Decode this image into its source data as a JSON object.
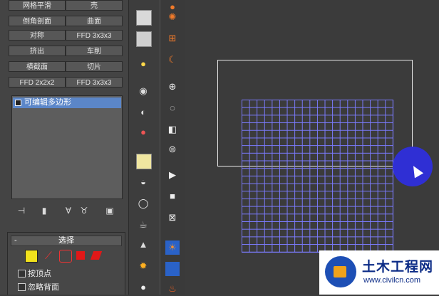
{
  "modifiers": {
    "row1": [
      "网格平滑",
      "壳"
    ],
    "row2": [
      "倒角剖面",
      "曲面"
    ],
    "row3": [
      "对称",
      "FFD 3x3x3"
    ],
    "row4": [
      "挤出",
      "车削"
    ],
    "row5": [
      "横截面",
      "切片"
    ],
    "row6": [
      "FFD 2x2x2",
      "FFD 3x3x3"
    ]
  },
  "stack": {
    "item_label": "可编辑多边形"
  },
  "selection": {
    "rollout_title": "选择",
    "collapse_symbol": "-",
    "options": [
      "按顶点",
      "忽略背面"
    ]
  },
  "watermark": {
    "title": "土木工程网",
    "url": "www.civilcn.com"
  },
  "colors": {
    "mesh": "#7b7bff",
    "stack_highlight": "#5b86c8",
    "cursor_dot": "#2f2fd4"
  }
}
